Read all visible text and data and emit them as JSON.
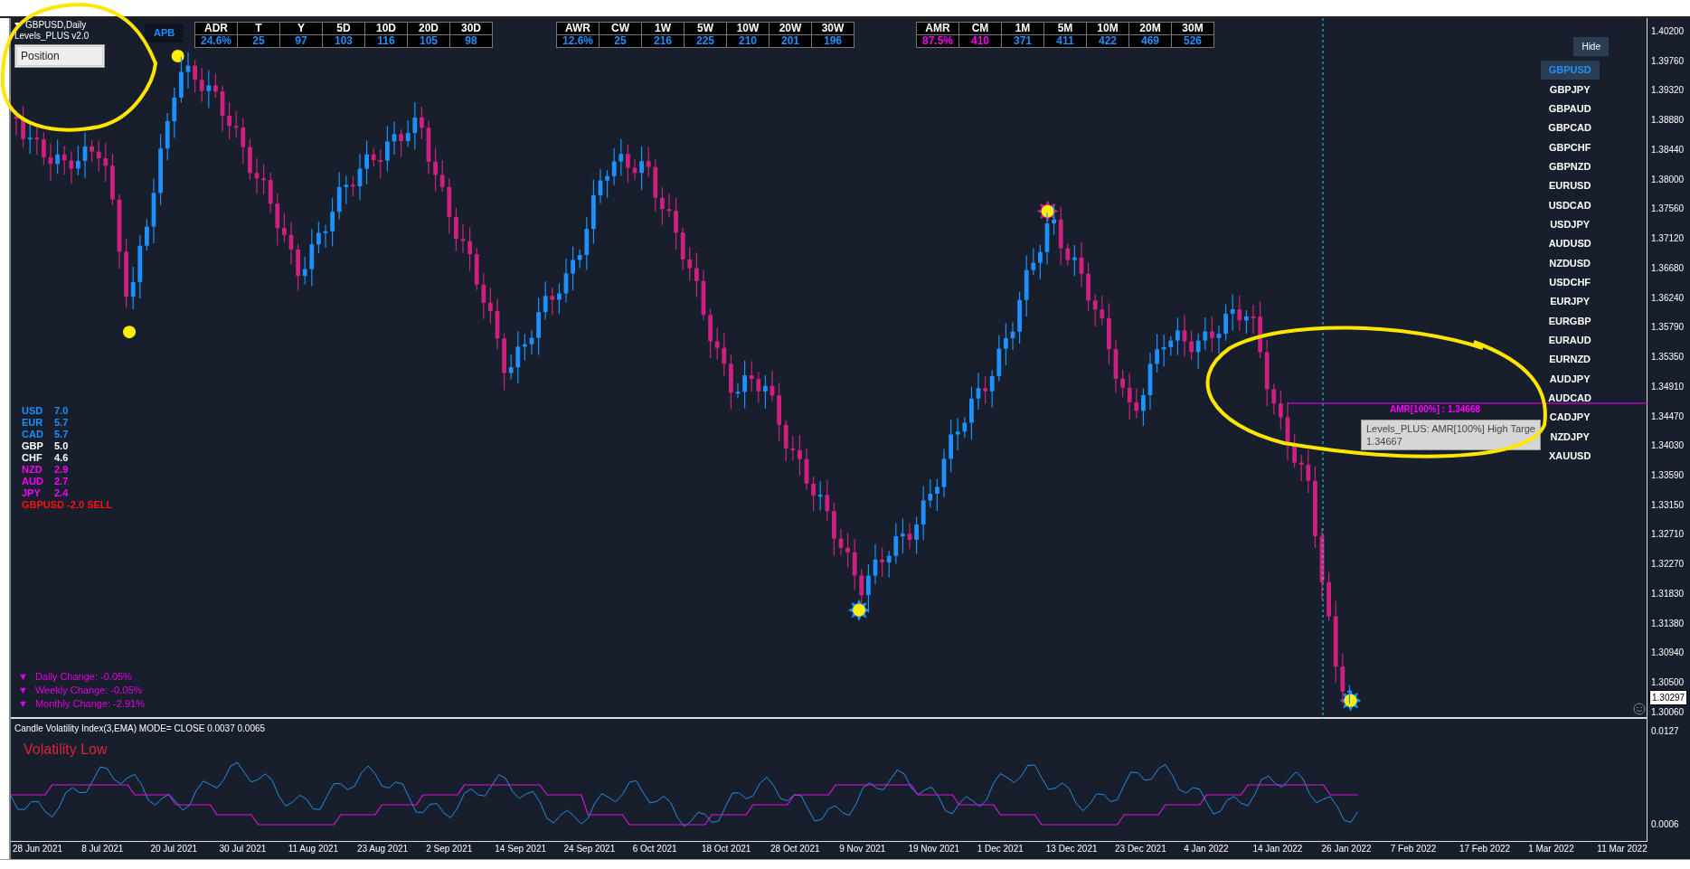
{
  "header": {
    "symbol": "GBPUSD,Daily",
    "indicator": "Levels_PLUS v2.0",
    "position_button": "Position",
    "apb_label": "APB"
  },
  "range_tables": [
    {
      "headers": [
        "ADR",
        "T",
        "Y",
        "5D",
        "10D",
        "20D",
        "30D"
      ],
      "values": [
        {
          "text": "24.6%",
          "highlighted": false
        },
        {
          "text": "25",
          "highlighted": false
        },
        {
          "text": "97",
          "highlighted": false
        },
        {
          "text": "103",
          "highlighted": false
        },
        {
          "text": "116",
          "highlighted": false
        },
        {
          "text": "105",
          "highlighted": false
        },
        {
          "text": "98",
          "highlighted": false
        }
      ]
    },
    {
      "headers": [
        "AWR",
        "CW",
        "1W",
        "5W",
        "10W",
        "20W",
        "30W"
      ],
      "values": [
        {
          "text": "12.6%",
          "highlighted": false
        },
        {
          "text": "25",
          "highlighted": false
        },
        {
          "text": "216",
          "highlighted": false
        },
        {
          "text": "225",
          "highlighted": false
        },
        {
          "text": "210",
          "highlighted": false
        },
        {
          "text": "201",
          "highlighted": false
        },
        {
          "text": "196",
          "highlighted": false
        }
      ]
    },
    {
      "headers": [
        "AMR",
        "CM",
        "1M",
        "5M",
        "10M",
        "20M",
        "30M"
      ],
      "values": [
        {
          "text": "87.5%",
          "highlighted": true
        },
        {
          "text": "410",
          "highlighted": true
        },
        {
          "text": "371",
          "highlighted": false
        },
        {
          "text": "411",
          "highlighted": false
        },
        {
          "text": "422",
          "highlighted": false
        },
        {
          "text": "469",
          "highlighted": false
        },
        {
          "text": "526",
          "highlighted": false
        }
      ]
    }
  ],
  "hide_button": "Hide",
  "symbols": [
    {
      "label": "GBPUSD",
      "selected": true
    },
    {
      "label": "GBPJPY",
      "selected": false
    },
    {
      "label": "GBPAUD",
      "selected": false
    },
    {
      "label": "GBPCAD",
      "selected": false
    },
    {
      "label": "GBPCHF",
      "selected": false
    },
    {
      "label": "GBPNZD",
      "selected": false
    },
    {
      "label": "EURUSD",
      "selected": false
    },
    {
      "label": "USDCAD",
      "selected": false
    },
    {
      "label": "USDJPY",
      "selected": false
    },
    {
      "label": "AUDUSD",
      "selected": false
    },
    {
      "label": "NZDUSD",
      "selected": false
    },
    {
      "label": "USDCHF",
      "selected": false
    },
    {
      "label": "EURJPY",
      "selected": false
    },
    {
      "label": "EURGBP",
      "selected": false
    },
    {
      "label": "EURAUD",
      "selected": false
    },
    {
      "label": "EURNZD",
      "selected": false
    },
    {
      "label": "AUDJPY",
      "selected": false
    },
    {
      "label": "AUDCAD",
      "selected": false
    },
    {
      "label": "CADJPY",
      "selected": false
    },
    {
      "label": "NZDJPY",
      "selected": false
    },
    {
      "label": "XAUUSD",
      "selected": false
    }
  ],
  "currency_strength": [
    {
      "currency": "USD",
      "value": "7.0",
      "color": "#1e90ff"
    },
    {
      "currency": "EUR",
      "value": "5.7",
      "color": "#1e90ff"
    },
    {
      "currency": "CAD",
      "value": "5.7",
      "color": "#1e90ff"
    },
    {
      "currency": "GBP",
      "value": "5.0",
      "color": "#ffffff"
    },
    {
      "currency": "CHF",
      "value": "4.6",
      "color": "#ffffff"
    },
    {
      "currency": "NZD",
      "value": "2.9",
      "color": "#ff00ff"
    },
    {
      "currency": "AUD",
      "value": "2.7",
      "color": "#ff00ff"
    },
    {
      "currency": "JPY",
      "value": "2.4",
      "color": "#ff00ff"
    }
  ],
  "signal": "GBPUSD -2.0 SELL",
  "changes": [
    {
      "marker": "▼",
      "text": "Daily Change: -0.05%"
    },
    {
      "marker": "▼",
      "text": "Weekly Change: -0.05%"
    },
    {
      "marker": "▼",
      "text": "Monthly Change: -2.91%"
    }
  ],
  "amr_level": {
    "label": "AMR[100%] : 1.34668"
  },
  "tooltip": {
    "lines": [
      "Levels_PLUS: AMR[100%] High Targe",
      "1.34667"
    ]
  },
  "price_axis": {
    "ticks": [
      "1.40200",
      "1.39760",
      "1.39320",
      "1.38880",
      "1.38440",
      "1.38000",
      "1.37560",
      "1.37120",
      "1.36680",
      "1.36240",
      "1.35790",
      "1.35350",
      "1.34910",
      "1.34470",
      "1.34030",
      "1.33590",
      "1.33150",
      "1.32710",
      "1.32270",
      "1.31830",
      "1.31380",
      "1.30940",
      "1.30500",
      "1.30060"
    ],
    "current_price": "1.30297"
  },
  "indicator": {
    "title": "Candle Volatility Index(3,EMA) MODE= CLOSE 0.0037 0.0065",
    "status": "Volatility Low",
    "axis_ticks": [
      "0.0127",
      "0.0006"
    ]
  },
  "date_axis": [
    "28 Jun 2021",
    "8 Jul 2021",
    "20 Jul 2021",
    "30 Jul 2021",
    "11 Aug 2021",
    "23 Aug 2021",
    "2 Sep 2021",
    "14 Sep 2021",
    "24 Sep 2021",
    "6 Oct 2021",
    "18 Oct 2021",
    "28 Oct 2021",
    "9 Nov 2021",
    "19 Nov 2021",
    "1 Dec 2021",
    "13 Dec 2021",
    "23 Dec 2021",
    "4 Jan 2022",
    "14 Jan 2022",
    "26 Jan 2022",
    "7 Feb 2022",
    "17 Feb 2022",
    "1 Mar 2022",
    "11 Mar 2022"
  ]
}
